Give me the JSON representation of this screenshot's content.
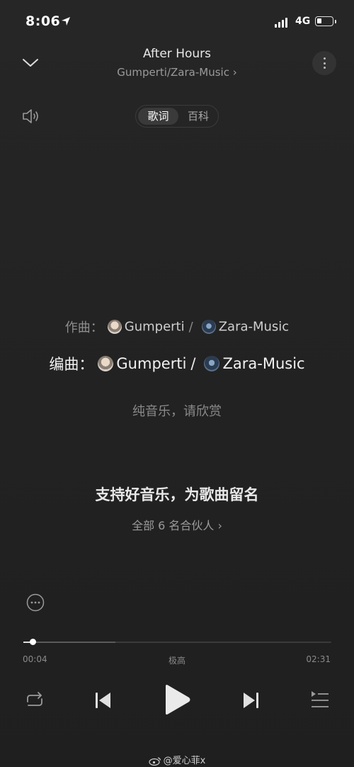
{
  "status_bar": {
    "time": "8:06",
    "network": "4G",
    "battery_level": 0.3
  },
  "header": {
    "title": "After Hours",
    "artist": "Gumperti/Zara-Music",
    "artist_chevron": "›"
  },
  "tabs": {
    "lyrics": "歌词",
    "wiki": "百科",
    "selected": "歌词"
  },
  "credits": {
    "composer_label": "作曲：",
    "arranger_label": "编曲：",
    "people": [
      "Gumperti",
      "Zara-Music"
    ],
    "separator": "/"
  },
  "pure_music": "纯音乐，请欣赏",
  "support": {
    "text": "支持好音乐，为歌曲留名",
    "partners": "全部 6 名合伙人 ›"
  },
  "player": {
    "current_time": "00:04",
    "total_time": "02:31",
    "quality": "极高",
    "progress": 0.03
  },
  "watermark": "@爱心菲x",
  "colors": {
    "background": "#232323",
    "text_primary": "#f2f2f2",
    "text_secondary": "#8e8e8e"
  },
  "icons": [
    "location-arrow-icon",
    "signal-icon",
    "battery-icon",
    "chevron-down-icon",
    "more-vertical-icon",
    "speaker-icon",
    "comment-icon",
    "repeat-icon",
    "previous-icon",
    "play-icon",
    "next-icon",
    "playlist-icon",
    "weibo-icon"
  ]
}
